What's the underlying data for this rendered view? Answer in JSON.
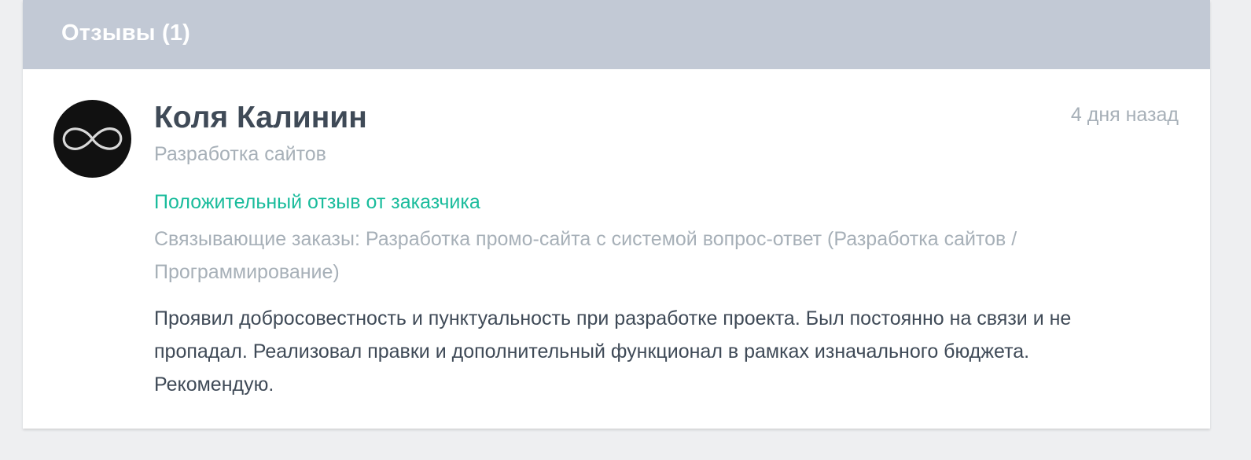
{
  "header": {
    "title": "Отзывы (1)"
  },
  "review": {
    "avatar_icon": "infinity-icon",
    "author_name": "Коля Калинин",
    "author_category": "Разработка сайтов",
    "time_ago": "4 дня назад",
    "review_type": "Положительный отзыв от заказчика",
    "related_orders": "Связывающие заказы: Разработка промо-сайта с системой вопрос-ответ (Разработка сайтов / Программирование)",
    "text": "Проявил добросовестность и пунктуальность при разработке проекта. Был постоянно на связи и не пропадал. Реализовал правки и дополнительный функционал в рамках изначального бюджета. Рекомендую."
  },
  "colors": {
    "header_bg": "#c2c9d5",
    "page_bg": "#eeeff1",
    "positive": "#1abc9c",
    "muted": "#a7b0b8",
    "text": "#3f4a57"
  }
}
